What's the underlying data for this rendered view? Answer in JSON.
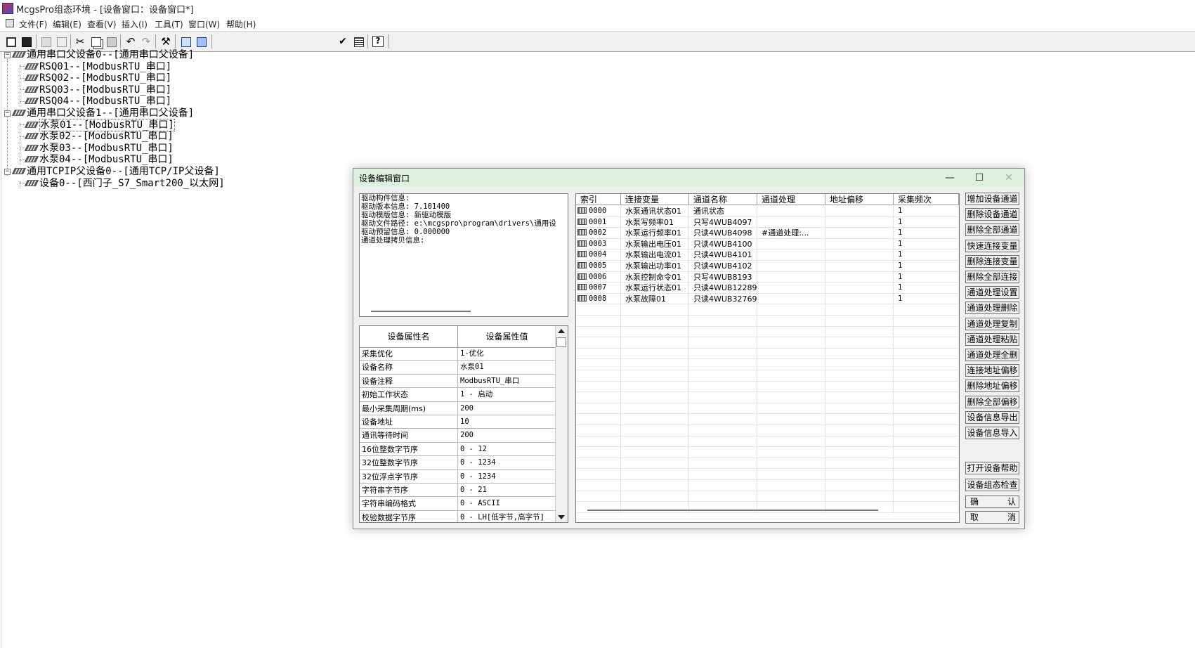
{
  "window": {
    "title": "McgsPro组态环境 - [设备窗口：设备窗口*]"
  },
  "menu": [
    "文件(F)",
    "编辑(E)",
    "查看(V)",
    "插入(I)",
    "工具(T)",
    "窗口(W)",
    "帮助(H)"
  ],
  "tree": [
    {
      "label": "通用串口父设备0--[通用串口父设备]"
    },
    {
      "label": "RSQ01--[ModbusRTU_串口]"
    },
    {
      "label": "RSQ02--[ModbusRTU_串口]"
    },
    {
      "label": "RSQ03--[ModbusRTU_串口]"
    },
    {
      "label": "RSQ04--[ModbusRTU_串口]"
    },
    {
      "label": "通用串口父设备1--[通用串口父设备]"
    },
    {
      "label": "水泵01--[ModbusRTU_串口]"
    },
    {
      "label": "水泵02--[ModbusRTU_串口]"
    },
    {
      "label": "水泵03--[ModbusRTU_串口]"
    },
    {
      "label": "水泵04--[ModbusRTU_串口]"
    },
    {
      "label": "通用TCPIP父设备0--[通用TCP/IP父设备]"
    },
    {
      "label": "设备0--[西门子_S7_Smart200_以太网]"
    }
  ],
  "dialog": {
    "title": "设备编辑窗口",
    "minimize": "—",
    "maximize": "☐",
    "close": "✕",
    "info_lines": [
      "驱动构件信息:",
      "驱动版本信息: 7.101400",
      "驱动模版信息: 新驱动模版",
      "驱动文件路径: e:\\mcgspro\\program\\drivers\\通用设",
      "驱动预留信息: 0.000000",
      "通道处理拷贝信息:"
    ],
    "prop_headers": {
      "name": "设备属性名",
      "value": "设备属性值"
    },
    "props": [
      {
        "name": "采集优化",
        "value": "1-优化"
      },
      {
        "name": "设备名称",
        "value": "水泵01"
      },
      {
        "name": "设备注释",
        "value": "ModbusRTU_串口"
      },
      {
        "name": "初始工作状态",
        "value": "1 - 启动"
      },
      {
        "name": "最小采集周期(ms)",
        "value": "200"
      },
      {
        "name": "设备地址",
        "value": "10"
      },
      {
        "name": "通讯等待时间",
        "value": "200"
      },
      {
        "name": "16位整数字节序",
        "value": "0 - 12"
      },
      {
        "name": "32位整数字节序",
        "value": "0 - 1234"
      },
      {
        "name": "32位浮点字节序",
        "value": "0 - 1234"
      },
      {
        "name": "字符串字节序",
        "value": "0 - 21"
      },
      {
        "name": "字符串编码格式",
        "value": "0 - ASCII"
      },
      {
        "name": "校验数据字节序",
        "value": "0 - LH[低字节,高字节]"
      }
    ],
    "channel_headers": [
      "索引",
      "连接变量",
      "通道名称",
      "通道处理",
      "地址偏移",
      "采集频次"
    ],
    "channels": [
      {
        "index": "0000",
        "var": "水泵通讯状态01",
        "name": "通讯状态",
        "proc": "",
        "offset": "",
        "freq": "1"
      },
      {
        "index": "0001",
        "var": "水泵写频率01",
        "name": "只写4WUB4097",
        "proc": "",
        "offset": "",
        "freq": "1"
      },
      {
        "index": "0002",
        "var": "水泵运行频率01",
        "name": "只读4WUB4098",
        "proc": "#通道处理:...",
        "offset": "",
        "freq": "1"
      },
      {
        "index": "0003",
        "var": "水泵输出电压01",
        "name": "只读4WUB4100",
        "proc": "",
        "offset": "",
        "freq": "1"
      },
      {
        "index": "0004",
        "var": "水泵输出电流01",
        "name": "只读4WUB4101",
        "proc": "",
        "offset": "",
        "freq": "1"
      },
      {
        "index": "0005",
        "var": "水泵输出功率01",
        "name": "只读4WUB4102",
        "proc": "",
        "offset": "",
        "freq": "1"
      },
      {
        "index": "0006",
        "var": "水泵控制命令01",
        "name": "只写4WUB8193",
        "proc": "",
        "offset": "",
        "freq": "1"
      },
      {
        "index": "0007",
        "var": "水泵运行状态01",
        "name": "只读4WUB12289",
        "proc": "",
        "offset": "",
        "freq": "1"
      },
      {
        "index": "0008",
        "var": "水泵故障01",
        "name": "只读4WUB32769",
        "proc": "",
        "offset": "",
        "freq": "1"
      }
    ],
    "buttons": [
      "增加设备通道",
      "删除设备通道",
      "删除全部通道",
      "快速连接变量",
      "删除连接变量",
      "删除全部连接",
      "通道处理设置",
      "通道处理删除",
      "通道处理复制",
      "通道处理粘贴",
      "通道处理全删",
      "连接地址偏移",
      "删除地址偏移",
      "删除全部偏移",
      "设备信息导出",
      "设备信息导入",
      "打开设备帮助",
      "设备组态检查"
    ],
    "ok": [
      "确",
      "认"
    ],
    "cancel": [
      "取",
      "消"
    ]
  }
}
